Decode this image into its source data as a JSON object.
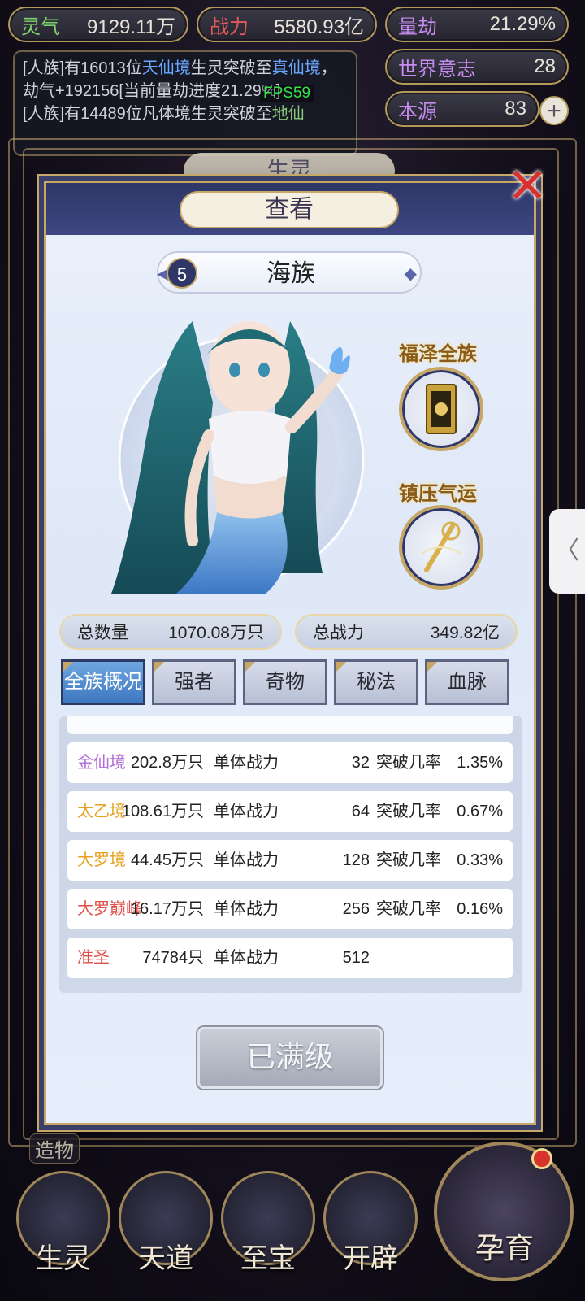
{
  "hud": {
    "lingqi": {
      "label": "灵气",
      "value": "9129.11万"
    },
    "zhanli": {
      "label": "战力",
      "value": "5580.93亿"
    },
    "liangjie": {
      "label": "量劫",
      "value": "21.29%"
    },
    "world_will": {
      "label": "世界意志",
      "value": "28"
    },
    "origin": {
      "label": "本源",
      "value": "83"
    },
    "plus": "+"
  },
  "log": {
    "line1_pre": "[人族]有16013位",
    "line1_hl": "天仙境",
    "line1_mid": "生灵突破至",
    "line1_hl2": "真仙境",
    "line1_post": "，劫气+192156[当前量劫进度21.29%]",
    "line2_pre": "[人族]有14489位凡体境生灵突破至",
    "line2_hl": "地仙"
  },
  "fps": "FPS59",
  "behind_title": "生灵",
  "dialog": {
    "title": "查看",
    "close": "✕",
    "race_level": "5",
    "race_name": "海族",
    "trait1": "福泽全族",
    "trait2": "镇压气运",
    "total_count_label": "总数量",
    "total_count_value": "1070.08万只",
    "total_power_label": "总战力",
    "total_power_value": "349.82亿",
    "tabs": [
      "全族概况",
      "强者",
      "奇物",
      "秘法",
      "血脉"
    ],
    "active_tab": 0,
    "stage_unit_label": "单体战力",
    "stage_rate_label": "突破几率",
    "stages": [
      {
        "name": "金仙境",
        "count": "202.8万只",
        "power": "32",
        "rate": "1.35%",
        "color": "#b06ad8"
      },
      {
        "name": "太乙境",
        "count": "108.61万只",
        "power": "64",
        "rate": "0.67%",
        "color": "#e8a020"
      },
      {
        "name": "大罗境",
        "count": "44.45万只",
        "power": "128",
        "rate": "0.33%",
        "color": "#e8a020"
      },
      {
        "name": "大罗巅峰",
        "count": "16.17万只",
        "power": "256",
        "rate": "0.16%",
        "color": "#e0504a"
      },
      {
        "name": "准圣",
        "count": "74784只",
        "power": "512",
        "rate": "",
        "color": "#e0504a"
      }
    ],
    "max_level": "已满级"
  },
  "side_tab": "〈",
  "bottom_nav": {
    "craft": "造物",
    "items": [
      "生灵",
      "天道",
      "至宝",
      "开辟"
    ],
    "breed": "孕育"
  }
}
